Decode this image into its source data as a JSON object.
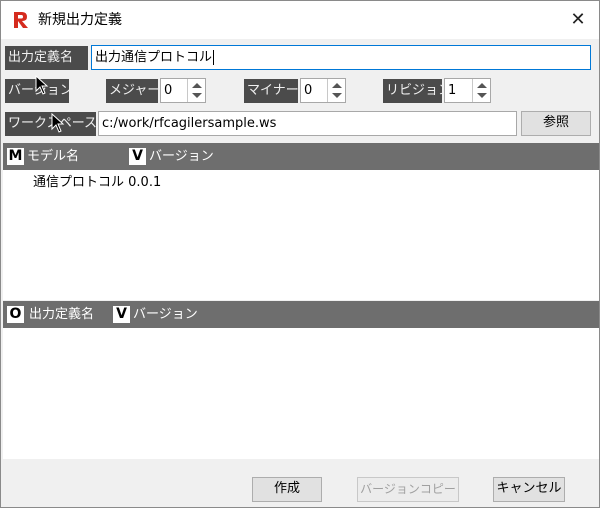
{
  "window": {
    "title": "新規出力定義",
    "app_icon_letter": "R",
    "brand_color": "#d52b1e"
  },
  "form": {
    "output_def_name_label": "出力定義名",
    "output_def_name_value": "出力通信プロトコル",
    "version_label": "バージョン",
    "major_label": "メジャー",
    "major_value": "0",
    "minor_label": "マイナー",
    "minor_value": "0",
    "revision_label": "リビジョン",
    "revision_value": "1",
    "workspace_label": "ワークスペース",
    "workspace_value": "c:/work/rfcagilersample.ws",
    "browse_button": "参照"
  },
  "model_grid": {
    "sort_badge_1": "M",
    "col1": "モデル名",
    "sort_badge_2": "V",
    "col2": "バージョン",
    "rows": [
      {
        "name": "通信プロトコル",
        "version": "0.0.1"
      }
    ]
  },
  "output_grid": {
    "sort_badge_1": "O",
    "col1": "出力定義名",
    "sort_badge_2": "V",
    "col2": "バージョン",
    "rows": []
  },
  "footer": {
    "create_button": "作成",
    "version_copy_button": "バージョンコピー",
    "cancel_button": "キャンセル"
  },
  "icons": {
    "close": "close-icon",
    "spin_up": "chevron-up-icon",
    "spin_down": "chevron-down-icon",
    "cursor": "mouse-pointer-icon"
  }
}
